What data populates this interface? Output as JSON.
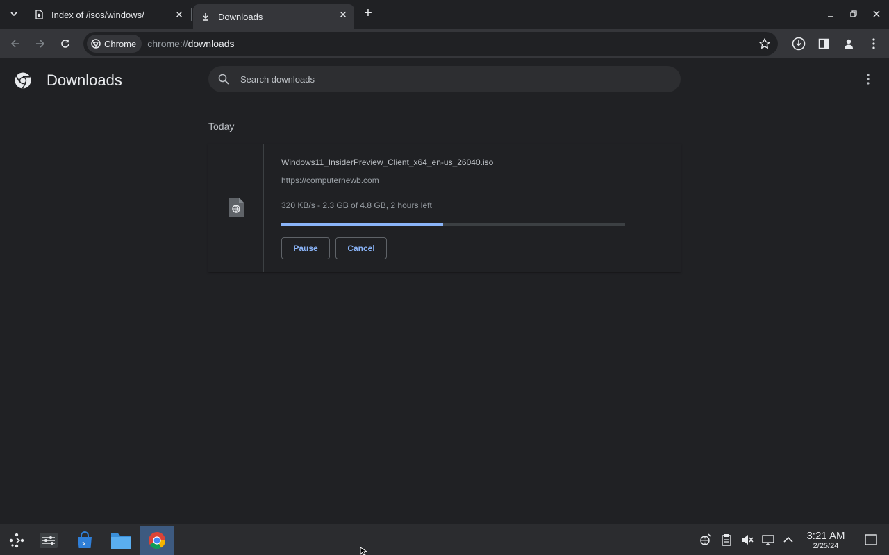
{
  "tabs": [
    {
      "title": "Index of /isos/windows/",
      "icon": "page-icon"
    },
    {
      "title": "Downloads",
      "icon": "download-icon",
      "active": true
    }
  ],
  "omnibox": {
    "chip": "Chrome",
    "url_scheme": "chrome://",
    "url_host": "downloads"
  },
  "page": {
    "title": "Downloads",
    "search_placeholder": "Search downloads",
    "section": "Today"
  },
  "download": {
    "filename": "Windows11_InsiderPreview_Client_x64_en-us_26040.iso",
    "source": "https://computernewb.com",
    "status": "320 KB/s - 2.3 GB of 4.8 GB, 2 hours left",
    "progress_percent": 47,
    "pause_label": "Pause",
    "cancel_label": "Cancel"
  },
  "taskbar": {
    "apps": [
      "app-launcher-icon",
      "settings-sliders-icon",
      "store-bag-icon",
      "file-manager-icon",
      "chrome-icon"
    ],
    "tray": [
      "network-icon",
      "clipboard-icon",
      "muted-speaker-icon",
      "display-icon",
      "chevron-up-icon"
    ],
    "time": "3:21 AM",
    "date": "2/25/24"
  },
  "colors": {
    "accent": "#8ab4f8",
    "background": "#202124",
    "toolbar": "#35363a"
  }
}
